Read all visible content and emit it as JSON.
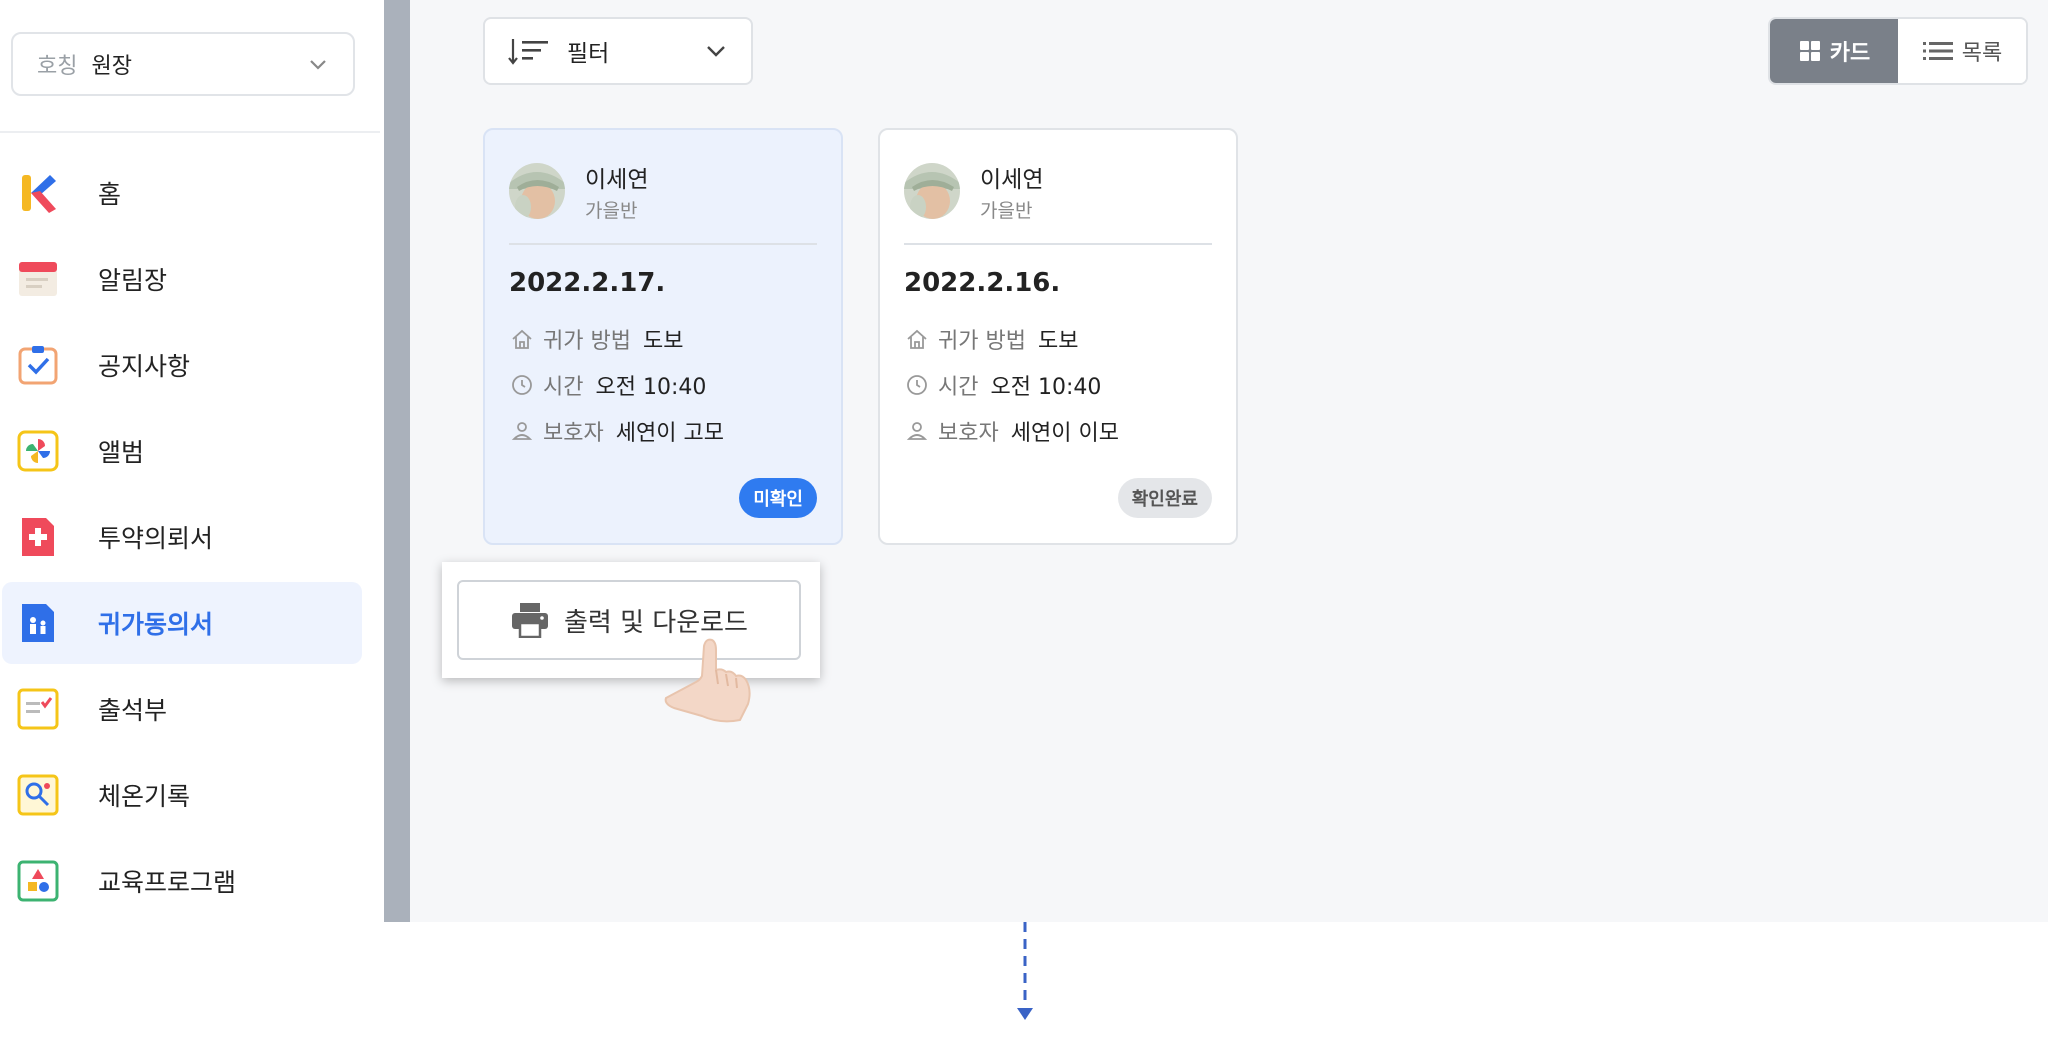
{
  "sidebar": {
    "title_select": {
      "label": "호칭",
      "value": "원장"
    },
    "items": [
      {
        "label": "홈",
        "icon": "kidsnote-logo-icon"
      },
      {
        "label": "알림장",
        "icon": "notebook-icon"
      },
      {
        "label": "공지사항",
        "icon": "notice-check-icon"
      },
      {
        "label": "앨범",
        "icon": "album-pinwheel-icon"
      },
      {
        "label": "투약의뢰서",
        "icon": "medicine-cross-icon"
      },
      {
        "label": "귀가동의서",
        "icon": "going-home-icon",
        "active": true
      },
      {
        "label": "출석부",
        "icon": "attendance-icon"
      },
      {
        "label": "체온기록",
        "icon": "thermometer-record-icon"
      },
      {
        "label": "교육프로그램",
        "icon": "education-shapes-icon"
      }
    ]
  },
  "toolbar": {
    "filter_label": "필터",
    "view_card_label": "카드",
    "view_list_label": "목록"
  },
  "cards": [
    {
      "name": "이세연",
      "class": "가을반",
      "date": "2022.2.17.",
      "method_key": "귀가 방법",
      "method_val": "도보",
      "time_key": "시간",
      "time_val": "오전 10:40",
      "guardian_key": "보호자",
      "guardian_val": "세연이 고모",
      "status": "미확인"
    },
    {
      "name": "이세연",
      "class": "가을반",
      "date": "2022.2.16.",
      "method_key": "귀가 방법",
      "method_val": "도보",
      "time_key": "시간",
      "time_val": "오전 10:40",
      "guardian_key": "보호자",
      "guardian_val": "세연이 이모",
      "status": "확인완료"
    }
  ],
  "print_button_label": "출력 및 다운로드",
  "colors": {
    "accent": "#2f6fe8",
    "badge_unread": "#2f7bf0",
    "toggle_active": "#7a8089",
    "arrow": "#3a63c6"
  }
}
